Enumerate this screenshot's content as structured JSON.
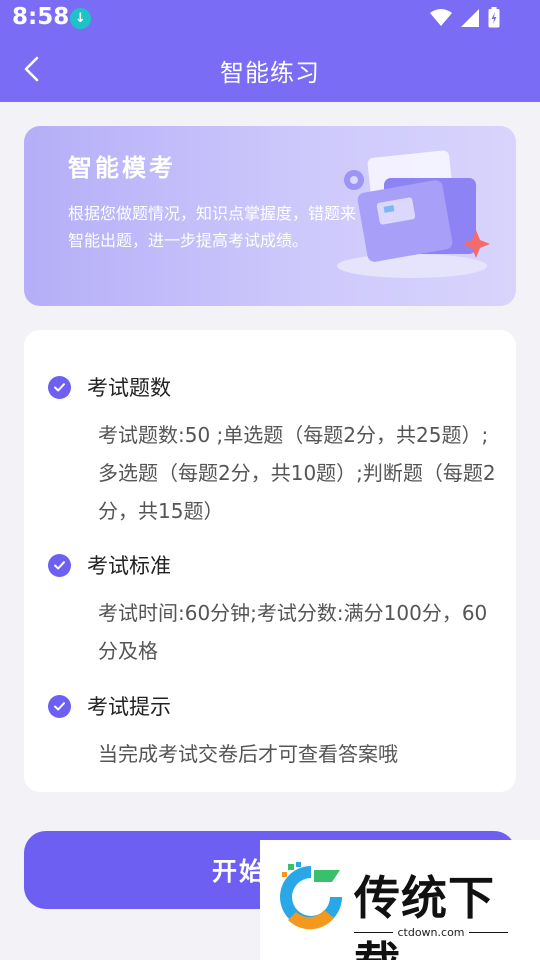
{
  "status_bar": {
    "time": "8:58",
    "icons": [
      "download-icon",
      "wifi-icon",
      "signal-icon",
      "battery-icon"
    ]
  },
  "header": {
    "title": "智能练习",
    "back_icon": "chevron-left-icon"
  },
  "banner": {
    "title": "智能模考",
    "description": "根据您做题情况，知识点掌握度，错题来智能出题，进一步提高考试成绩。"
  },
  "sections": [
    {
      "title": "考试题数",
      "body": "考试题数:50 ;单选题（每题2分，共25题）;多选题（每题2分，共10题）;判断题（每题2分，共15题）"
    },
    {
      "title": "考试标准",
      "body": "考试时间:60分钟;考试分数:满分100分，60分及格"
    },
    {
      "title": "考试提示",
      "body": "当完成考试交卷后才可查看答案哦"
    }
  ],
  "start_button": {
    "label": "开始"
  },
  "watermark": {
    "name": "传统下载",
    "url": "ctdown.com"
  },
  "colors": {
    "primary": "#7b6cf6",
    "accent": "#6c5ff2",
    "background": "#f3f3f7"
  }
}
